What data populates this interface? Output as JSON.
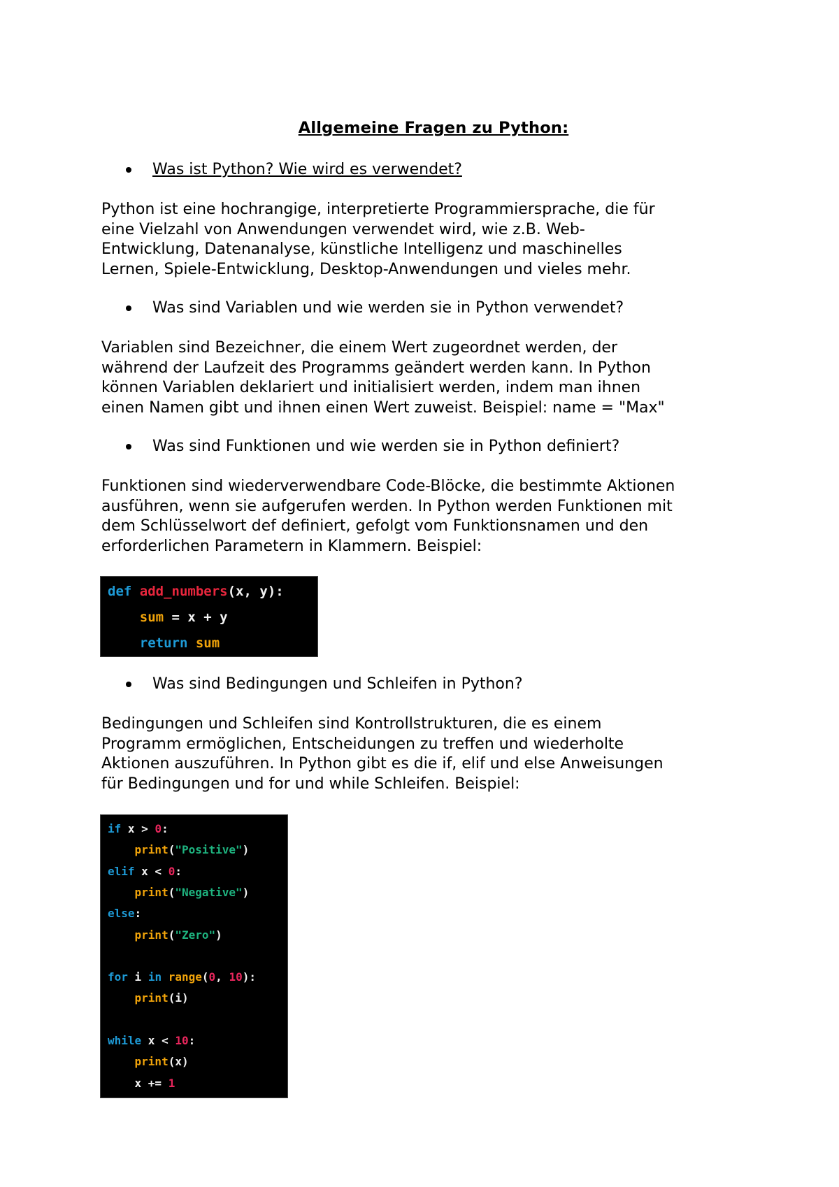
{
  "document": {
    "title": "Allgemeine Fragen zu Python:",
    "sections": [
      {
        "question": "Was ist Python? Wie wird es verwendet?",
        "answer_lines": [
          "Python ist eine hochrangige, interpretierte Programmiersprache, die für",
          "eine Vielzahl von Anwendungen verwendet wird, wie z.B. Web-",
          "Entwicklung, Datenanalyse, künstliche Intelligenz und maschinelles",
          "Lernen, Spiele-Entwicklung, Desktop-Anwendungen und vieles mehr."
        ]
      },
      {
        "question": "Was sind Variablen und wie werden sie in Python verwendet?",
        "answer_lines": [
          "Variablen sind Bezeichner, die einem Wert zugeordnet werden, der",
          "während der Laufzeit des Programms geändert werden kann. In Python",
          "können Variablen deklariert und initialisiert werden, indem man ihnen",
          "einen Namen gibt und ihnen einen Wert zuweist. Beispiel: name = \"Max\""
        ]
      },
      {
        "question": "Was sind Funktionen und wie werden sie in Python definiert?",
        "answer_lines": [
          "Funktionen sind wiederverwendbare Code-Blöcke, die bestimmte Aktionen",
          "ausführen, wenn sie aufgerufen werden. In Python werden Funktionen mit",
          "dem Schlüsselwort def definiert, gefolgt vom Funktionsnamen und den",
          "erforderlichen Parametern in Klammern. Beispiel:"
        ]
      },
      {
        "question": "Was sind Bedingungen und Schleifen in Python?",
        "answer_lines": [
          "Bedingungen und Schleifen sind Kontrollstrukturen, die es einem",
          "Programm ermöglichen, Entscheidungen zu treffen und wiederholte",
          "Aktionen auszuführen. In Python gibt es die if, elif und else Anweisungen",
          "für Bedingungen und for und while Schleifen. Beispiel:"
        ]
      }
    ],
    "code_blocks": [
      {
        "lines": [
          [
            [
              "kw",
              "def"
            ],
            [
              "wh",
              " "
            ],
            [
              "fn",
              "add_numbers"
            ],
            [
              "wh",
              "(x, y):"
            ]
          ],
          [
            [
              "wh",
              "    "
            ],
            [
              "or",
              "sum"
            ],
            [
              "wh",
              " = x + y"
            ]
          ],
          [
            [
              "wh",
              "    "
            ],
            [
              "kw",
              "return"
            ],
            [
              "wh",
              " "
            ],
            [
              "or",
              "sum"
            ]
          ]
        ]
      },
      {
        "lines": [
          [
            [
              "kw",
              "if"
            ],
            [
              "wh",
              " x > "
            ],
            [
              "nu",
              "0"
            ],
            [
              "wh",
              ":"
            ]
          ],
          [
            [
              "wh",
              "    "
            ],
            [
              "or",
              "print"
            ],
            [
              "wh",
              "("
            ],
            [
              "st",
              "\"Positive\""
            ],
            [
              "wh",
              ")"
            ]
          ],
          [
            [
              "kw",
              "elif"
            ],
            [
              "wh",
              " x < "
            ],
            [
              "nu",
              "0"
            ],
            [
              "wh",
              ":"
            ]
          ],
          [
            [
              "wh",
              "    "
            ],
            [
              "or",
              "print"
            ],
            [
              "wh",
              "("
            ],
            [
              "st",
              "\"Negative\""
            ],
            [
              "wh",
              ")"
            ]
          ],
          [
            [
              "kw",
              "else"
            ],
            [
              "wh",
              ":"
            ]
          ],
          [
            [
              "wh",
              "    "
            ],
            [
              "or",
              "print"
            ],
            [
              "wh",
              "("
            ],
            [
              "st",
              "\"Zero\""
            ],
            [
              "wh",
              ")"
            ]
          ],
          [],
          [
            [
              "kw",
              "for"
            ],
            [
              "wh",
              " i "
            ],
            [
              "kw",
              "in"
            ],
            [
              "wh",
              " "
            ],
            [
              "or",
              "range"
            ],
            [
              "wh",
              "("
            ],
            [
              "nu",
              "0"
            ],
            [
              "wh",
              ", "
            ],
            [
              "nu",
              "10"
            ],
            [
              "wh",
              "):"
            ]
          ],
          [
            [
              "wh",
              "    "
            ],
            [
              "or",
              "print"
            ],
            [
              "wh",
              "(i)"
            ]
          ],
          [],
          [
            [
              "kw",
              "while"
            ],
            [
              "wh",
              " x < "
            ],
            [
              "nu",
              "10"
            ],
            [
              "wh",
              ":"
            ]
          ],
          [
            [
              "wh",
              "    "
            ],
            [
              "or",
              "print"
            ],
            [
              "wh",
              "(x)"
            ]
          ],
          [
            [
              "wh",
              "    x += "
            ],
            [
              "nu",
              "1"
            ]
          ]
        ]
      }
    ]
  }
}
